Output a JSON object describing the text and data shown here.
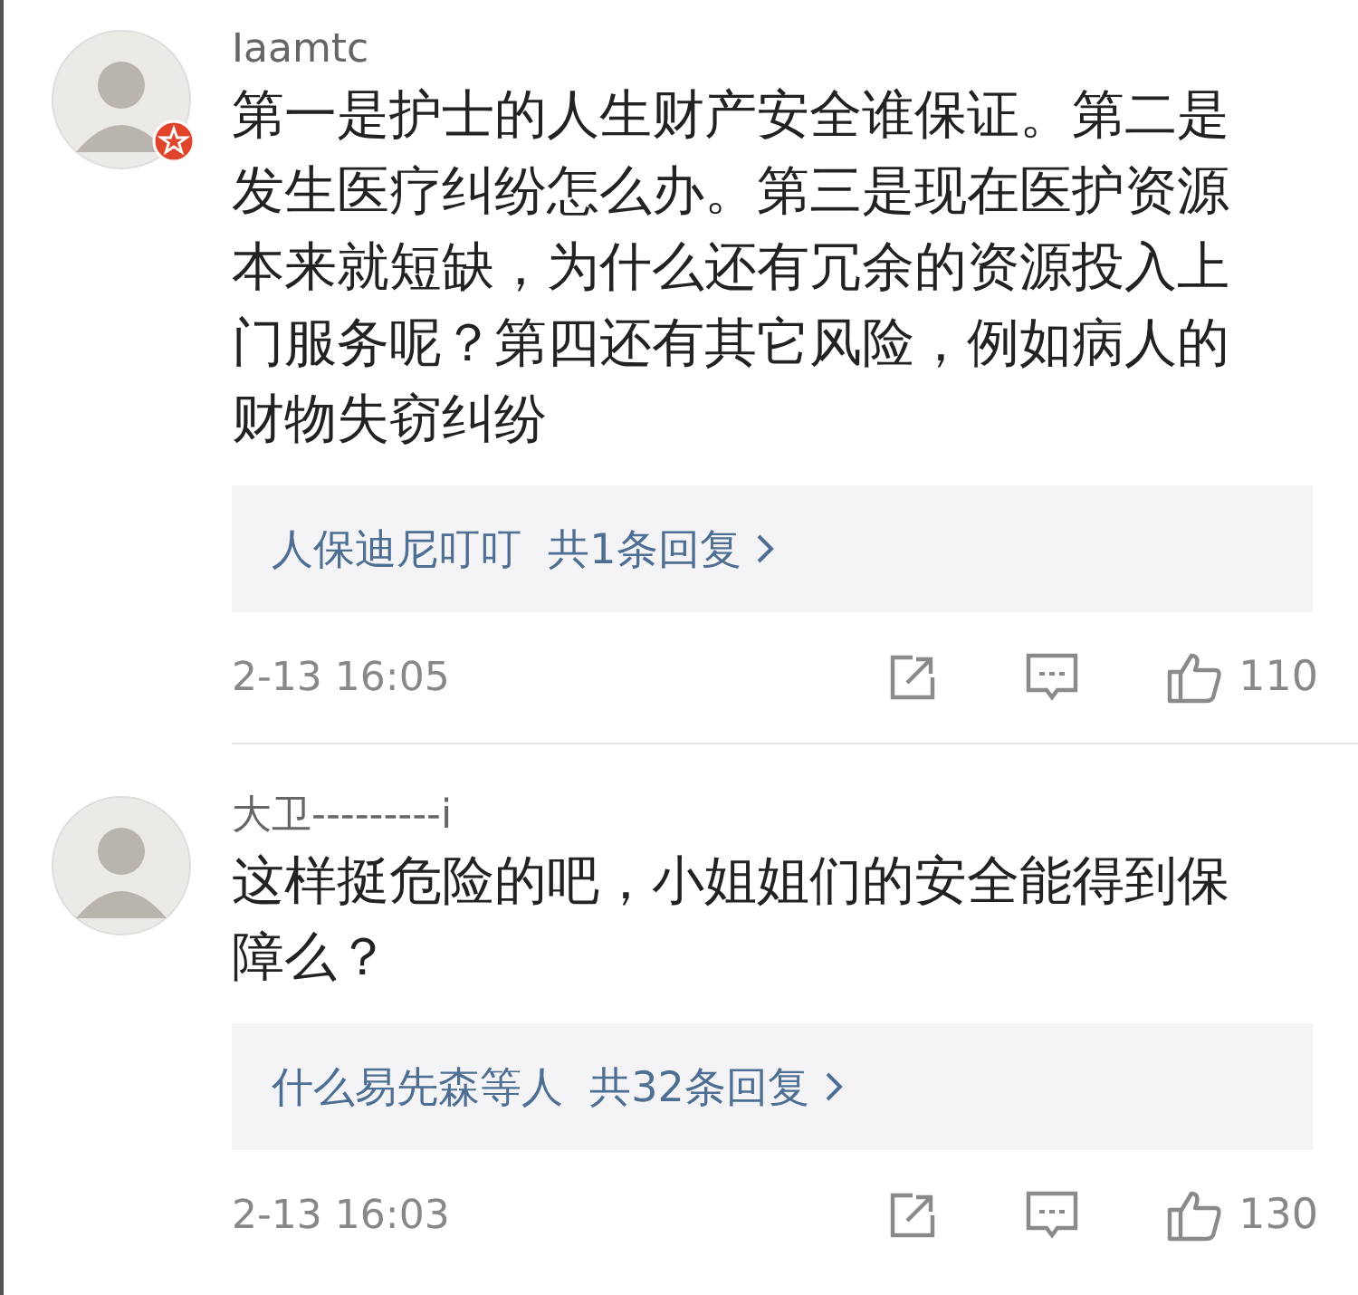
{
  "comments": [
    {
      "user": "Iaamtc",
      "badge": true,
      "text": "第一是护士的人生财产安全谁保证。第二是发生医疗纠纷怎么办。第三是现在医护资源本来就短缺，为什么还有冗余的资源投入上门服务呢？第四还有其它风险，例如病人的财物失窃纠纷",
      "replies": "人保迪尼叮叮  共1条回复",
      "time": "2-13 16:05",
      "likes": "110"
    },
    {
      "user": "大卫---------i",
      "badge": false,
      "text": "这样挺危险的吧，小姐姐们的安全能得到保障么？",
      "replies": "什么易先森等人  共32条回复",
      "time": "2-13 16:03",
      "likes": "130"
    }
  ]
}
